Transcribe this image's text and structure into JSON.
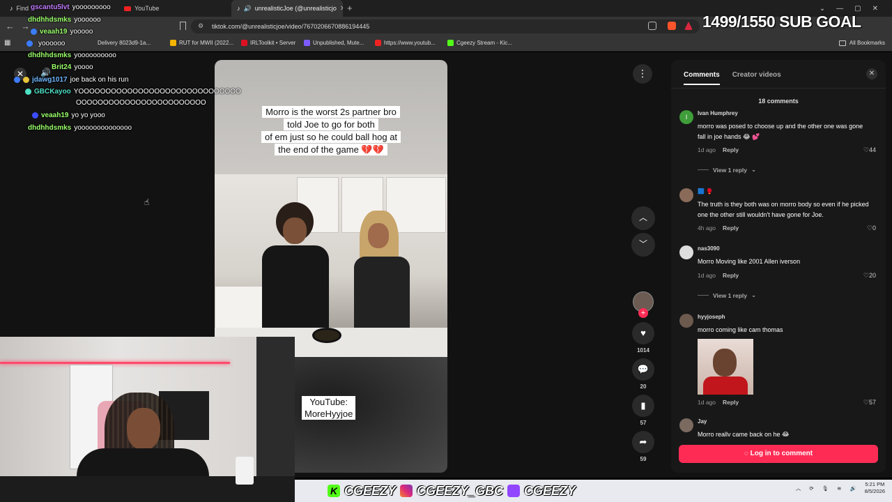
{
  "browser": {
    "tabs": [
      {
        "label": "Find"
      },
      {
        "label": "YouTube"
      },
      {
        "label": "unrealisticJoe (@unrealisticjo"
      }
    ],
    "url": "tiktok.com/@unrealisticjoe/video/7670206670886194445",
    "bookmarks": [
      "Delivery 8023d9-1a...",
      "RUT for MWII (2022...",
      "IRLToolkit • Server",
      "Unpublished, Mute...",
      "https://www.youtub...",
      "Cgeezy Stream - Kic..."
    ],
    "all_bookmarks": "All Bookmarks"
  },
  "chat": [
    {
      "user": "gscantu5lvt",
      "msg": "yooooooooo",
      "color": "#c27bff"
    },
    {
      "user": "dhdhhdsmks",
      "msg": "yoooooo",
      "color": "#9aff6b"
    },
    {
      "user": "veaah19",
      "msg": "yooooo",
      "color": "#9aff6b"
    },
    {
      "user": "",
      "msg": "yoooooo",
      "color": "#6fb6ff"
    },
    {
      "user": "dhdhhdsmks",
      "msg": "yoooooooooo",
      "color": "#9aff6b"
    },
    {
      "user": "Brit24",
      "msg": "yoooo",
      "color": "#9aff6b"
    },
    {
      "user": "jdawg1017",
      "msg": "joe back on his run",
      "color": "#6fb6ff"
    },
    {
      "user": "GBCKayoo",
      "msg": "YOOOOOOOOOOOOOOOOOOOOOOOOOOOOOO",
      "msg2": "OOOOOOOOOOOOOOOOOOOOOOOO",
      "color": "#4ee0c5"
    },
    {
      "user": "veaah19",
      "msg": "yo yo yooo",
      "color": "#9aff6b"
    },
    {
      "user": "dhdhhdsmks",
      "msg": "yoooooooooooooo",
      "color": "#9aff6b"
    }
  ],
  "sub_goal": "1499/1550 SUB GOAL",
  "video": {
    "caption_lines": [
      "Morro is the worst 2s partner bro",
      "told Joe to go for both",
      "of em just so he could ball hog at",
      "the end of the game 💔💔"
    ],
    "yt_caption_lines": [
      "YouTube:",
      "MoreHyyjoe"
    ]
  },
  "actions": {
    "likes": "1014",
    "comments": "20",
    "saves": "57",
    "shares": "59"
  },
  "panel": {
    "tabs": [
      "Comments",
      "Creator videos"
    ],
    "count": "18 comments",
    "comments": [
      {
        "user": "Ivan Humphrey",
        "text": "morro was posed to choose up and the other one was gone fall in joe hands 😂 💕",
        "ago": "1d ago",
        "reply": "Reply",
        "likes": "44",
        "replies": "View 1 reply"
      },
      {
        "user": "🟦 🥊",
        "text": "The truth is they both was on morro body so even if he picked one the other still wouldn't have gone for Joe.",
        "ago": "4h ago",
        "reply": "Reply",
        "likes": "0"
      },
      {
        "user": "nas3090",
        "text": "Morro Moving like 2001 Allen iverson",
        "ago": "1d ago",
        "reply": "Reply",
        "likes": "20",
        "replies": "View 1 reply"
      },
      {
        "user": "hyyjoseph",
        "text": "morro coming like cam thomas",
        "ago": "1d ago",
        "reply": "Reply",
        "likes": "57"
      },
      {
        "user": "Jay",
        "text": "Morro really came back on he 😂"
      }
    ],
    "login": "Log in to comment"
  },
  "socials": [
    "CGEEZY",
    "CGEEZY_GBC",
    "CGEEZY"
  ],
  "tray": {
    "time": "5:21 PM",
    "date": "8/5/2026"
  },
  "colors": {
    "tiktok_red": "#fe2c55",
    "kick_green": "#53fc18",
    "twitch_purple": "#9146ff"
  }
}
